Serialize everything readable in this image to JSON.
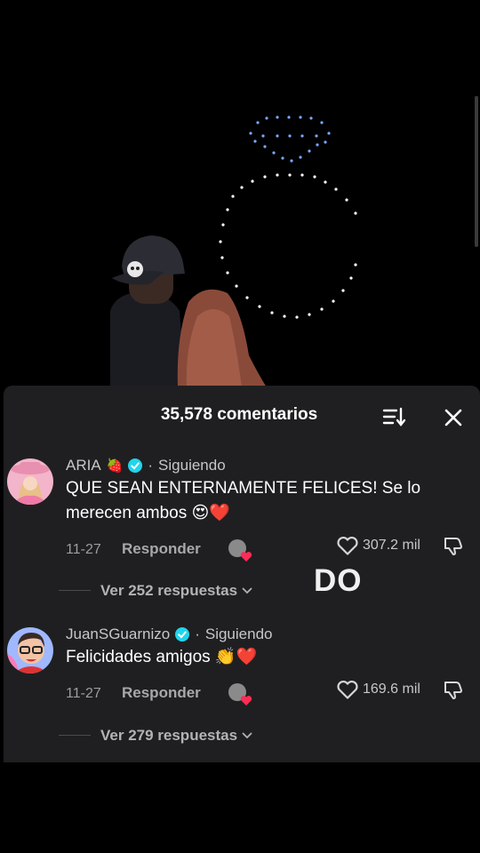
{
  "comments_panel": {
    "title": "35,578 comentarios",
    "comments": [
      {
        "username": "ARIA",
        "follow_label": "Siguiendo",
        "text": "QUE SEAN ENTERNAMENTE FELICES! Se lo merecen ambos 😍❤️",
        "date": "11-27",
        "reply_label": "Responder",
        "likes": "307.2 mil",
        "view_replies": "Ver 252 respuestas"
      },
      {
        "username": "JuanSGuarnizo",
        "follow_label": "Siguiendo",
        "text": "Felicidades amigos 👏❤️",
        "date": "11-27",
        "reply_label": "Responder",
        "likes": "169.6 mil",
        "view_replies": "Ver 279 respuestas"
      }
    ]
  },
  "overlay_text": "DO",
  "colors": {
    "sheet_bg": "#1f1f21",
    "verified": "#20d5ec",
    "heart": "#fe2c55",
    "drone_blue": "#7aa8ff"
  },
  "icons": [
    "sort-icon",
    "close-icon",
    "verified-badge-icon",
    "heart-outline-icon",
    "dislike-icon",
    "chevron-down-icon",
    "strawberry-icon"
  ]
}
